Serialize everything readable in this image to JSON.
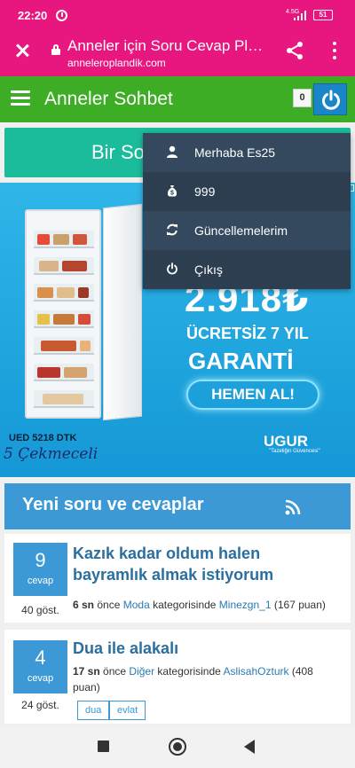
{
  "status_bar": {
    "time": "22:20",
    "network": "4.5G",
    "battery": "51"
  },
  "browser": {
    "title": "Anneler için Soru Cevap Platf…",
    "url": "anneleroplandik.com"
  },
  "site": {
    "name": "Anneler Sohbet",
    "notification_count": "0"
  },
  "ask_button": {
    "label": "Bir Soru Sor"
  },
  "ad": {
    "price": "2.918₺",
    "line1": "ÜCRETSİZ 7 YIL",
    "line2": "GARANTİ",
    "cta": "HEMEN AL!",
    "model": "UED 5218 DTK",
    "model_script": "5 Çekmeceli",
    "brand": "UGUR",
    "brand_tagline": "\"Tazeliğin Güvencesi\""
  },
  "profile_menu": {
    "greeting": "Merhaba Es25",
    "points": "999",
    "updates": "Güncellemelerim",
    "logout": "Çıkış"
  },
  "feed": {
    "title": "Yeni soru ve cevaplar",
    "questions": [
      {
        "answers": "9",
        "answers_label": "cevap",
        "views": "40 göst.",
        "title": "Kazık kadar oldum halen bayramlık almak istiyorum",
        "time": "6 sn",
        "time_suffix": " önce ",
        "category": "Moda",
        "category_suffix": " kategorisinde ",
        "user": "Minezgn_1",
        "points": " (167 puan)",
        "tags": []
      },
      {
        "answers": "4",
        "answers_label": "cevap",
        "views": "24 göst.",
        "title": "Dua ile alakalı",
        "time": "17 sn",
        "time_suffix": " önce ",
        "category": "Diğer",
        "category_suffix": " kategorisinde ",
        "user": "AslisahOzturk",
        "points": " (408 puan)",
        "tags": [
          "dua",
          "evlat"
        ]
      }
    ]
  },
  "colors": {
    "chrome": "#e8177f",
    "site_header": "#3cad24",
    "ask_button": "#1abc9c",
    "menu": "#34495e",
    "accent_blue": "#3c99d6"
  }
}
